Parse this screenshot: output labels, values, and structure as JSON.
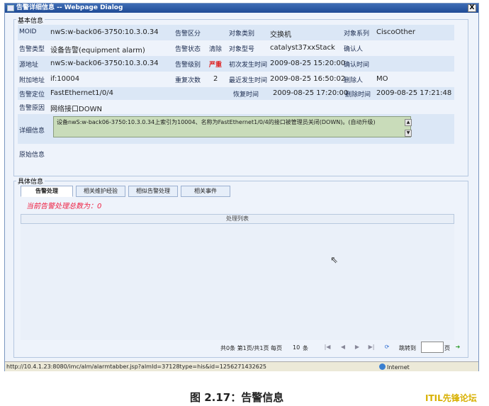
{
  "window": {
    "title": "告警详细信息 -- Webpage Dialog",
    "close": "X"
  },
  "basic": {
    "legend": "基本信息",
    "rows": [
      {
        "l1": "MOID",
        "v1": "nwS:w-back06-3750:10.3.0.34",
        "l2": "告警区分",
        "v2": "",
        "l3": "对象类别",
        "v3": "交换机",
        "l4": "对象系列",
        "v4": "CiscoOther"
      },
      {
        "l1": "告警类型",
        "v1": "设备告警(equipment alarm)",
        "l2": "告警状态",
        "v2": "清除",
        "l3": "对象型号",
        "v3": "catalyst37xxStack",
        "l4": "确认人",
        "v4": ""
      },
      {
        "l1": "源地址",
        "v1": "nwS:w-back06-3750:10.3.0.34",
        "l2": "告警级别",
        "v2": "严重",
        "l3": "初次发生时间",
        "v3": "2009-08-25 15:20:00",
        "l4": "确认时间",
        "v4": ""
      },
      {
        "l1": "附加地址",
        "v1": "if:10004",
        "l2": "重复次数",
        "v2": "2",
        "l3": "最近发生时间",
        "v3": "2009-08-25 16:50:02",
        "l4": "删除人",
        "v4": "MO"
      },
      {
        "l1": "告警定位",
        "v1": "FastEthernet1/0/4",
        "l2": "",
        "v2": "",
        "l3": "恢复时间",
        "v3": "2009-08-25 17:20:00",
        "l4": "删除时间",
        "v4": "2009-08-25 17:21:48"
      },
      {
        "l1": "告警原因",
        "v1": "网络接口DOWN"
      }
    ],
    "detail_label": "详细信息",
    "detail_text": "设备nwS:w-back06-3750:10.3.0.34上索引为10004、名称为FastEthernet1/0/4的接口被管理员关闭(DOWN)。(自动升级)",
    "raw_label": "原始信息"
  },
  "specific": {
    "legend": "具体信息",
    "tabs": [
      "告警处理",
      "相关维护经验",
      "相似告警处理",
      "相关事件"
    ],
    "count_text": "当前告警处理总数为：0",
    "list_header": "处理列表"
  },
  "pager": {
    "summary": "共0条 第1页/共1页 每页",
    "per_page": "10",
    "unit": "条",
    "jump_label": "跳转到",
    "page_label": "页"
  },
  "status": {
    "url": "http://10.4.1.23:8080/imc/alm/alarmtabber.jsp?almId=37128type=his&id=1256271432625",
    "zone": "Internet"
  },
  "caption": "图 2.17：告警信息",
  "watermark": "ITIL先锋论坛"
}
